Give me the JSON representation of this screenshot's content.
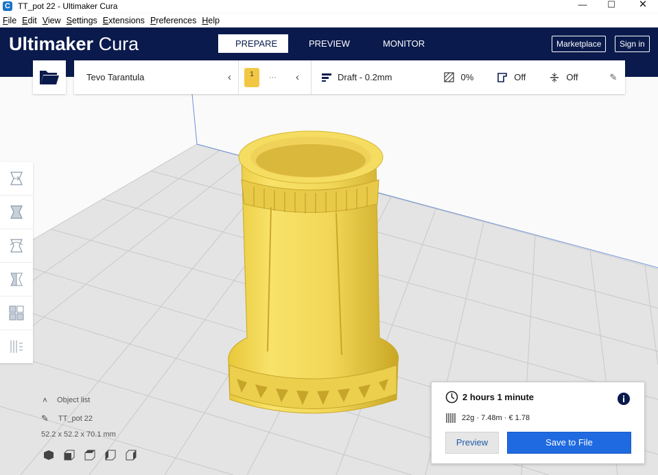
{
  "window": {
    "title": "TT_pot 22 - Ultimaker Cura",
    "icon_letter": "C"
  },
  "menu": [
    {
      "label": "File",
      "ul": "F",
      "rest": "ile"
    },
    {
      "label": "Edit",
      "ul": "E",
      "rest": "dit"
    },
    {
      "label": "View",
      "ul": "V",
      "rest": "iew"
    },
    {
      "label": "Settings",
      "ul": "S",
      "rest": "ettings"
    },
    {
      "label": "Extensions",
      "ul": "E",
      "rest": "xtensions"
    },
    {
      "label": "Preferences",
      "ul": "P",
      "rest": "references"
    },
    {
      "label": "Help",
      "ul": "H",
      "rest": "elp"
    }
  ],
  "header": {
    "logo_bold": "Ultimaker",
    "logo_light": " Cura",
    "tabs": [
      "PREPARE",
      "PREVIEW",
      "MONITOR"
    ],
    "marketplace": "Marketplace",
    "sign_in": "Sign in"
  },
  "toolbar": {
    "printer": "Tevo Tarantula",
    "extruder_num": "1",
    "extruder_more": "···",
    "profile": "Draft - 0.2mm",
    "infill": "0%",
    "support": "Off",
    "adhesion": "Off"
  },
  "object": {
    "list_label": "Object list",
    "name": "TT_pot 22",
    "dims": "52.2 x 52.2 x 70.1 mm"
  },
  "output": {
    "time": "2 hours 1 minute",
    "material": "22g · 7.48m · € 1.78",
    "preview": "Preview",
    "save": "Save to File"
  },
  "colors": {
    "header": "#0a1a4d",
    "accent": "#1f6ae0",
    "model": "#f7e06a"
  }
}
